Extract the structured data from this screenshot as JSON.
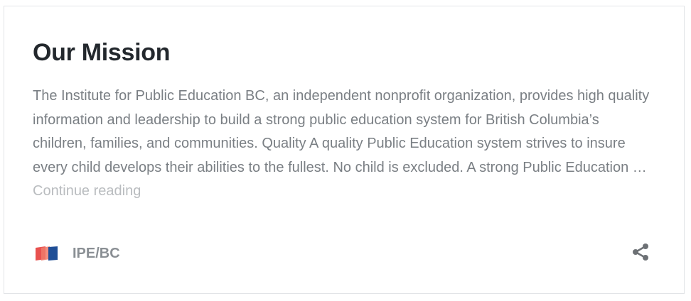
{
  "post": {
    "title": "Our Mission",
    "excerpt": "The Institute for Public Education BC, an independent nonprofit organization, provides high quality information and leadership to build a strong public education system for British Columbia’s children, families, and communities. Quality A quality Public Education system strives to insure every child develops their abilities to the fullest. No child is excluded. A strong Public Education … ",
    "continue_label": "Continue reading",
    "author": "IPE/BC"
  },
  "icons": {
    "logo": "ipebc-logo-icon",
    "share": "share-icon"
  },
  "colors": {
    "title": "#23282d",
    "excerpt": "#7a7f84",
    "continue": "#b9bcbf",
    "author": "#8a8f94",
    "border": "#e2e4e7",
    "logo_red": "#e8514f",
    "logo_blue": "#1f4e96"
  }
}
